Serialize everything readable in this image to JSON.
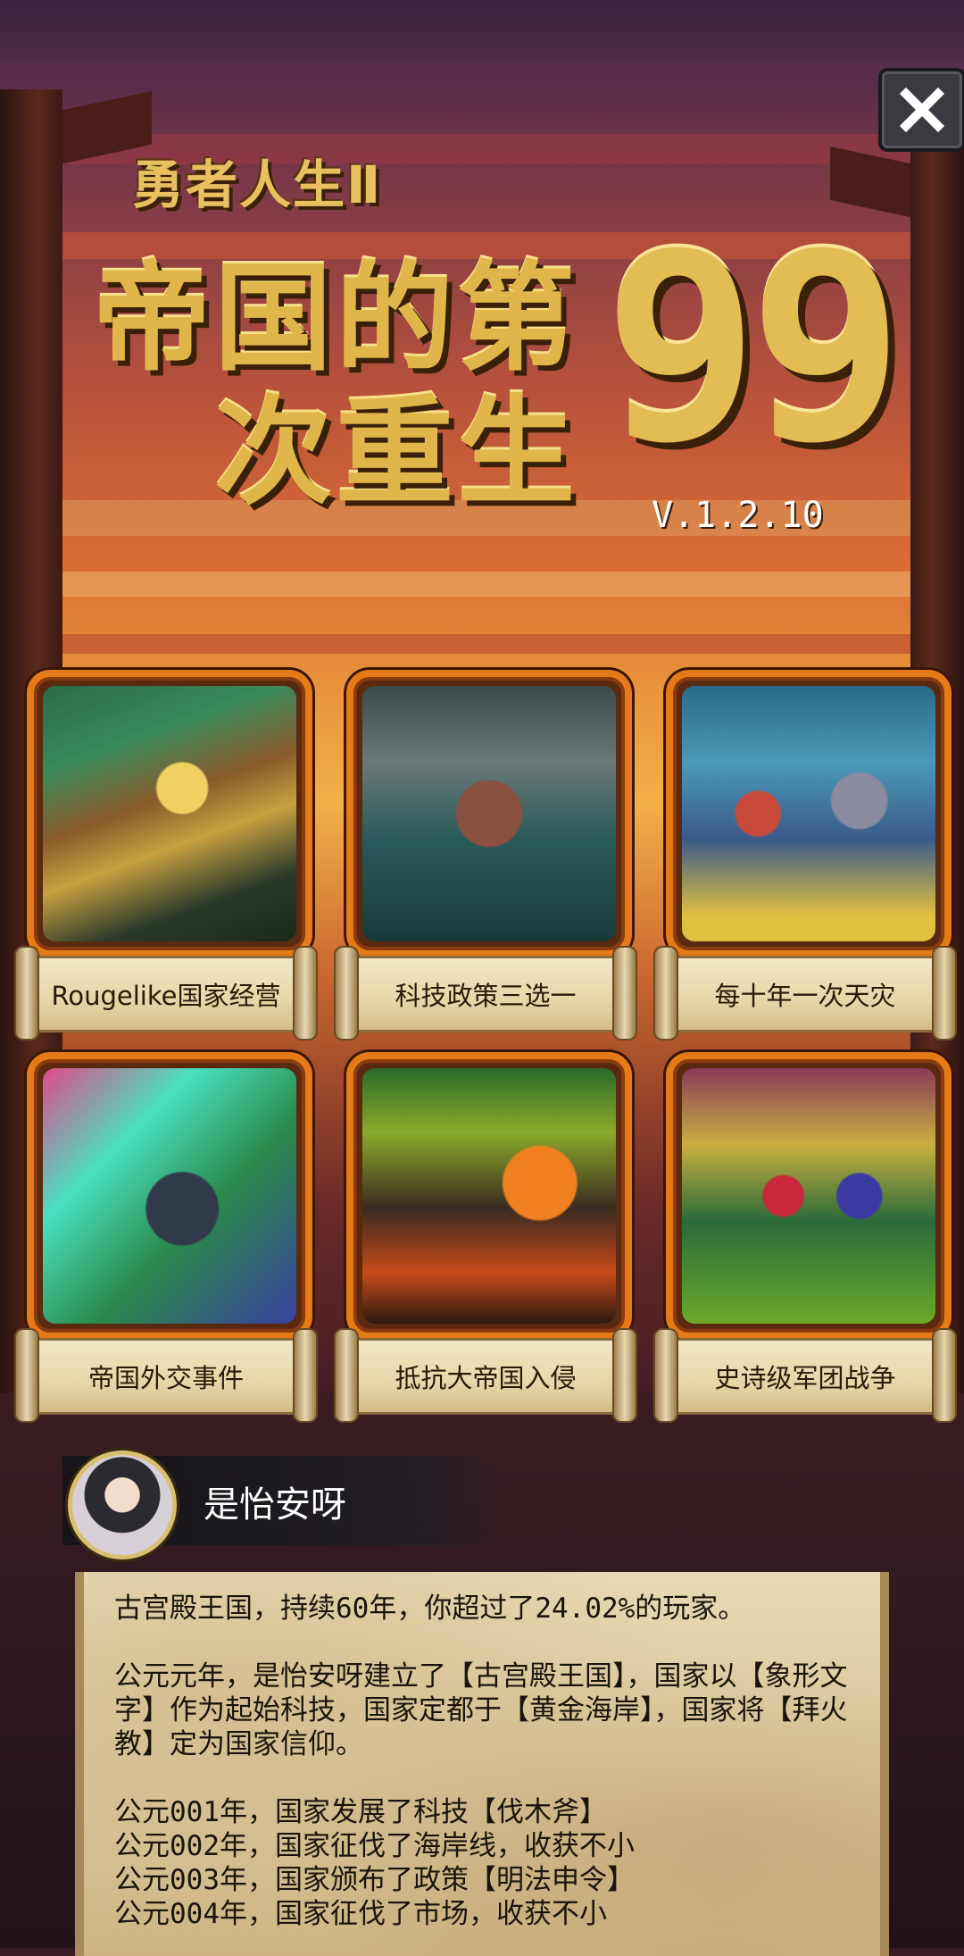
{
  "header": {
    "close_icon": "close-icon",
    "subtitle": "勇者人生Ⅱ",
    "title_line1": "帝国的第",
    "title_line2": "次重生",
    "title_number": "99",
    "version": "V.1.2.10"
  },
  "features": [
    {
      "label": "Rougelike国家经营",
      "art": "village-art"
    },
    {
      "label": "科技政策三选一",
      "art": "statue-art"
    },
    {
      "label": "每十年一次天灾",
      "art": "knights-battle-art"
    },
    {
      "label": "帝国外交事件",
      "art": "warrior-art"
    },
    {
      "label": "抵抗大帝国入侵",
      "art": "burning-city-art"
    },
    {
      "label": "史诗级军团战争",
      "art": "army-march-art"
    }
  ],
  "player": {
    "name": "是怡安呀",
    "avatar": "avatar-portrait"
  },
  "record": {
    "summary": "古宫殿王国，持续60年，你超过了24.02%的玩家。",
    "founding": "公元元年，是怡安呀建立了【古宫殿王国】，国家以【象形文字】作为起始科技，国家定都于【黄金海岸】，国家将【拜火教】定为国家信仰。",
    "log": [
      "公元001年，国家发展了科技【伐木斧】",
      "公元002年，国家征伐了海岸线，收获不小",
      "公元003年，国家颁布了政策【明法申令】",
      "公元004年，国家征伐了市场，收获不小"
    ]
  }
}
